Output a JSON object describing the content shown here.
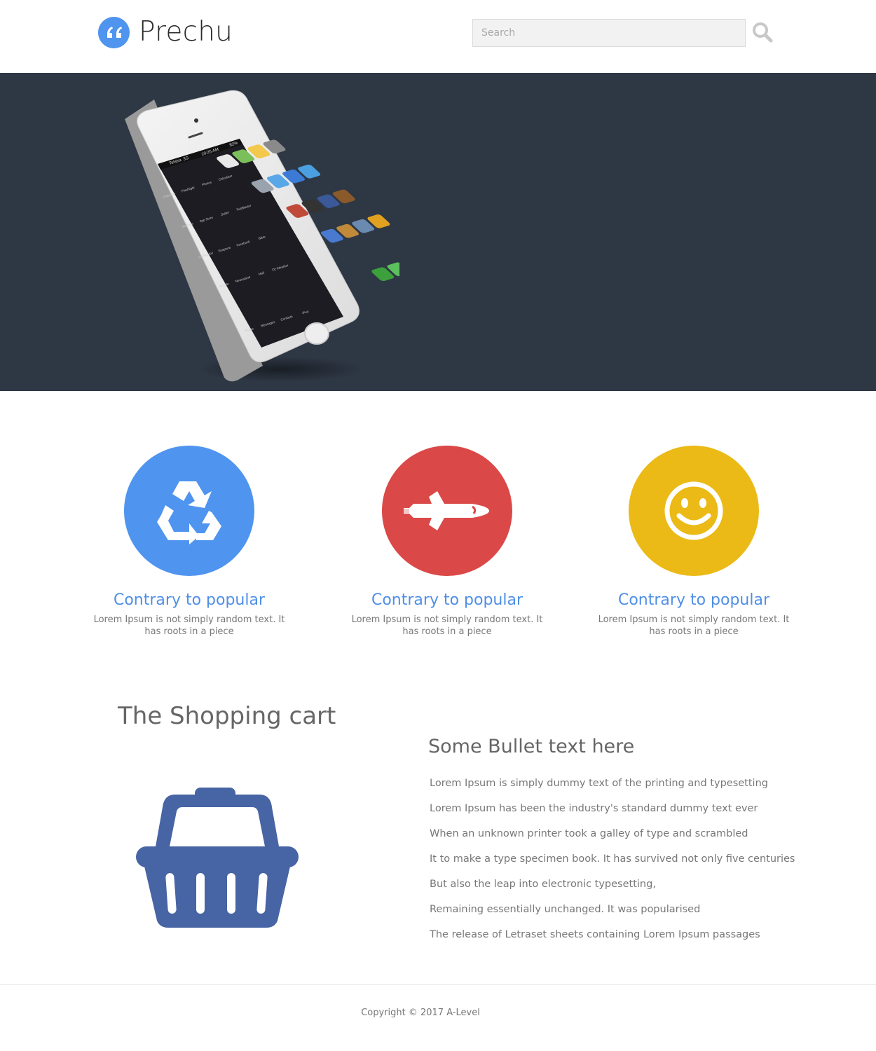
{
  "header": {
    "brand": "Prechu",
    "search_placeholder": "Search",
    "logo_color": "#4f94ef"
  },
  "hero": {
    "background": "#2e3744",
    "phone": {
      "carrier": "Telstra",
      "network": "3G",
      "time": "10:25 AM",
      "battery": "82%",
      "apps": [
        "Calendar",
        "Flashlight",
        "Photos",
        "Calculator",
        "Settings",
        "App Store",
        "Safari",
        "TwitBlaster",
        "CoPilot AU",
        "Snapture",
        "Facebook",
        "Bible",
        "Google",
        "Newsstand",
        "Mail",
        "Oz Weather"
      ],
      "dock": [
        "Phone",
        "Messages",
        "Contacts",
        "iPod"
      ]
    }
  },
  "features": [
    {
      "icon": "recycle-icon",
      "color": "#4f94ef",
      "title": "Contrary to popular",
      "text_line1": "Lorem Ipsum is not simply random text. It",
      "text_line2": "has roots in a piece"
    },
    {
      "icon": "space-shuttle-icon",
      "color": "#db4848",
      "title": "Contrary to popular",
      "text_line1": "Lorem Ipsum is not simply random text. It",
      "text_line2": "has roots in a piece"
    },
    {
      "icon": "smiley-icon",
      "color": "#ebba16",
      "title": "Contrary to popular",
      "text_line1": "Lorem Ipsum is not simply random text. It",
      "text_line2": "has roots in a piece"
    }
  ],
  "cart": {
    "heading": "The Shopping cart",
    "icon": "shopping-basket-icon",
    "icon_color": "#4764a4"
  },
  "bullets": {
    "heading": "Some Bullet text here",
    "items": [
      "Lorem Ipsum is simply dummy text of the printing and typesetting",
      "Lorem Ipsum has been the industry's standard dummy text ever",
      "When an unknown printer took a galley of type and scrambled",
      "It to make a type specimen book. It has survived not only five centuries",
      "But also the leap into electronic typesetting,",
      "Remaining essentially unchanged. It was popularised",
      "The release of Letraset sheets containing Lorem Ipsum passages"
    ]
  },
  "footer": {
    "copyright": "Copyright © 2017 A-Level"
  }
}
